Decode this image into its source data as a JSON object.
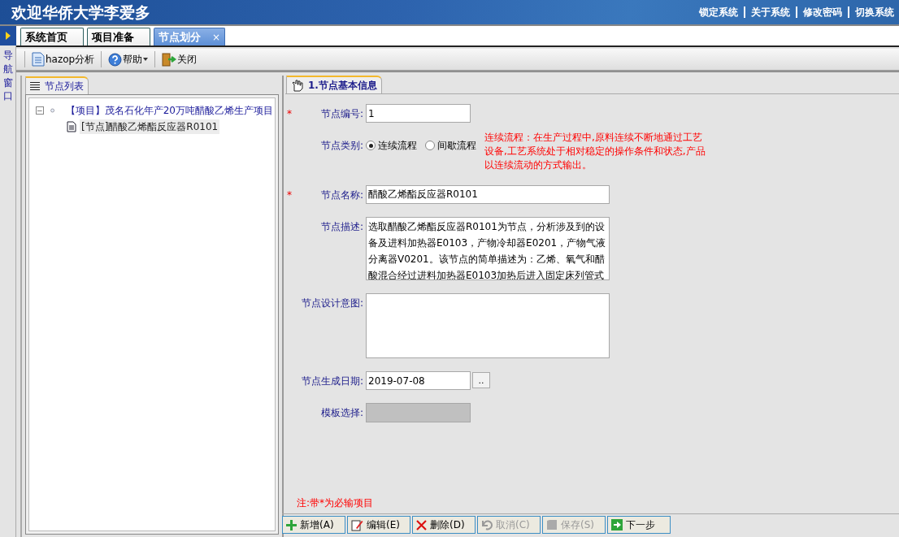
{
  "header": {
    "title": "欢迎华侨大学李爱多",
    "links": [
      "锁定系统",
      "关于系统",
      "修改密码",
      "切换系统"
    ]
  },
  "nav_strip": {
    "label": "导航窗口"
  },
  "tabs": [
    {
      "label": "系统首页",
      "selected": false
    },
    {
      "label": "项目准备",
      "selected": false
    },
    {
      "label": "节点划分",
      "selected": true,
      "close": "×"
    }
  ],
  "toolbar": [
    {
      "kind": "doc",
      "label": "hazop分析",
      "dropdown": false
    },
    {
      "kind": "help",
      "label": "帮助",
      "dropdown": true
    },
    {
      "kind": "exit",
      "label": "关闭",
      "dropdown": false
    }
  ],
  "tree_panel": {
    "title": "节点列表",
    "tree": [
      {
        "label": "【项目】茂名石化年产20万吨醋酸乙烯生产项目",
        "expanded": true,
        "expander": "−",
        "selected": false,
        "children": [
          {
            "label": "[节点]醋酸乙烯酯反应器R0101",
            "selected": true
          }
        ]
      }
    ]
  },
  "form_panel": {
    "title": "1.节点基本信息",
    "fields": [
      {
        "kind": "code",
        "label": "节点编号:",
        "required": true,
        "value": "1"
      },
      {
        "kind": "radio",
        "label": "节点类别:",
        "required": false,
        "options": [
          {
            "label": "连续流程",
            "selected": true
          },
          {
            "label": "间歇流程",
            "selected": false
          }
        ],
        "hint": "连续流程：在生产过程中,原料连续不断地通过工艺设备,工艺系统处于相对稳定的操作条件和状态,产品以连续流动的方式输出。"
      },
      {
        "kind": "text",
        "label": "节点名称:",
        "required": true,
        "value": "醋酸乙烯酯反应器R0101"
      },
      {
        "kind": "textarea",
        "label": "节点描述:",
        "required": false,
        "value": "选取醋酸乙烯酯反应器R0101为节点，分析涉及到的设备及进料加热器E0103，产物冷却器E0201，产物气液分离器V0201。该节点的简单描述为：乙烯、氧气和醋酸混合经过进料加热器E0103加热后进入固定床列管式"
      },
      {
        "kind": "textarea",
        "label": "节点设计意图:",
        "required": false
      },
      {
        "kind": "date",
        "label": "节点生成日期:",
        "required": false,
        "value": "2019-07-08",
        "button": ".."
      },
      {
        "kind": "select",
        "label": "模板选择:",
        "required": false,
        "disabled": true
      }
    ],
    "note": "注:带*为必输项目",
    "required_mark": "*",
    "buttons": [
      {
        "kind": "add",
        "label": "新增(A)",
        "disabled": false
      },
      {
        "kind": "edit",
        "label": "编辑(E)",
        "disabled": false
      },
      {
        "kind": "delete",
        "label": "删除(D)",
        "disabled": false
      },
      {
        "kind": "undo",
        "label": "取消(C)",
        "disabled": true
      },
      {
        "kind": "save",
        "label": "保存(S)",
        "disabled": true
      },
      {
        "kind": "next",
        "label": "下一步",
        "disabled": false
      }
    ]
  }
}
